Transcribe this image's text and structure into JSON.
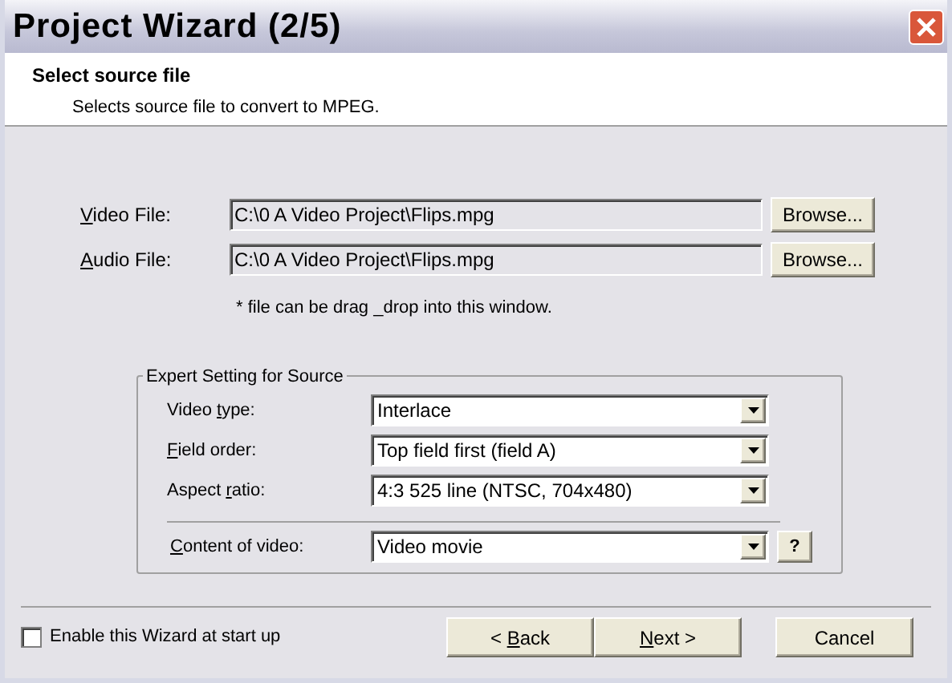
{
  "window": {
    "title": "Project Wizard (2/5)"
  },
  "header": {
    "title": "Select source file",
    "subtitle": "Selects source file to convert to MPEG."
  },
  "files": [
    {
      "label": {
        "key": "V",
        "post": "ideo File:"
      },
      "value": "C:\\0 A Video Project\\Flips.mpg",
      "button": "Browse..."
    },
    {
      "label": {
        "key": "A",
        "post": "udio File:"
      },
      "value": "C:\\0 A Video Project\\Flips.mpg",
      "button": "Browse..."
    }
  ],
  "note": "* file can be drag _drop into this window.",
  "group": {
    "title": "Expert Setting for Source",
    "settings": [
      {
        "label": {
          "pre": "Video ",
          "key": "t",
          "post": "ype:"
        },
        "value": "Interlace"
      },
      {
        "label": {
          "key": "F",
          "post": "ield order:"
        },
        "value": "Top field first (field A)"
      },
      {
        "label": {
          "pre": "Aspect ",
          "key": "r",
          "post": "atio:"
        },
        "value": "4:3 525 line (NTSC, 704x480)"
      }
    ],
    "content": {
      "label": {
        "key": "C",
        "post": "ontent of video:"
      },
      "value": "Video movie",
      "help": "?"
    }
  },
  "footer": {
    "checkbox": {
      "label": "Enable this Wizard at start up",
      "checked": false
    },
    "buttons": [
      {
        "pre": "< ",
        "key": "B",
        "post": "ack"
      },
      {
        "key": "N",
        "post": "ext >"
      },
      {
        "pre": "Cancel"
      }
    ]
  }
}
